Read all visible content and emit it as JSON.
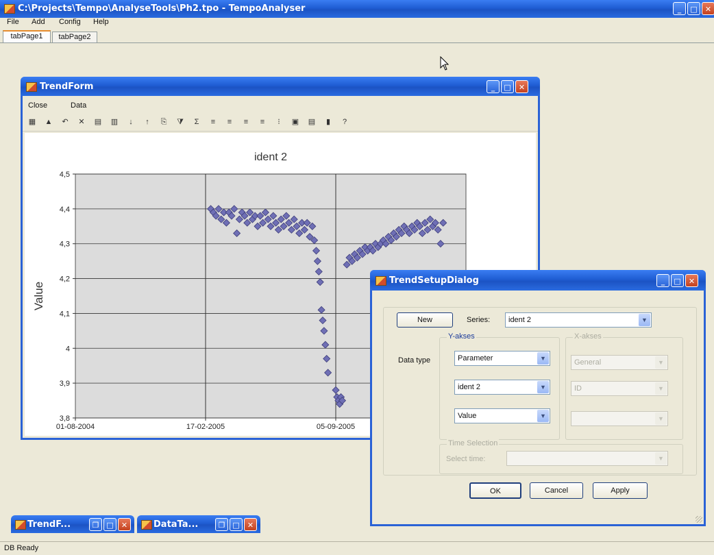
{
  "app": {
    "title": "C:\\Projects\\Tempo\\AnalyseTools\\Ph2.tpo  -  TempoAnalyser",
    "menu": [
      "File",
      "Add",
      "Config",
      "Help"
    ],
    "tabs": [
      "tabPage1",
      "tabPage2"
    ],
    "status": "DB Ready"
  },
  "trend_form": {
    "title": "TrendForm",
    "menu": [
      "Close",
      "Data"
    ],
    "toolbar_icons": [
      "grid-icon",
      "chart-icon",
      "undo-icon",
      "delete-icon",
      "table-icon",
      "list-icon",
      "sort-asc-icon",
      "sort-desc-icon",
      "copy-icon",
      "filter-icon",
      "sum-icon",
      "align-left-icon",
      "align-center-icon",
      "align-right-icon",
      "align-justify-icon",
      "info-icon",
      "export-icon",
      "print-icon",
      "book-icon",
      "help-icon"
    ]
  },
  "chart_data": {
    "type": "scatter",
    "title": "ident 2",
    "xlabel": "",
    "ylabel": "Value",
    "ylim": [
      3.8,
      4.5
    ],
    "yticks": [
      "4,5",
      "4,4",
      "4,3",
      "4,2",
      "4,1",
      "4",
      "3,9",
      "3,8"
    ],
    "xticks": [
      "01-08-2004",
      "17-02-2005",
      "05-09-2005"
    ],
    "series": [
      {
        "color": "#6f6fb5",
        "points": [
          [
            "2005-02-25",
            4.4
          ],
          [
            "2005-03-01",
            4.39
          ],
          [
            "2005-03-05",
            4.38
          ],
          [
            "2005-03-09",
            4.4
          ],
          [
            "2005-03-13",
            4.37
          ],
          [
            "2005-03-17",
            4.39
          ],
          [
            "2005-03-21",
            4.36
          ],
          [
            "2005-03-25",
            4.39
          ],
          [
            "2005-03-29",
            4.38
          ],
          [
            "2005-04-02",
            4.4
          ],
          [
            "2005-04-06",
            4.33
          ],
          [
            "2005-04-10",
            4.37
          ],
          [
            "2005-04-14",
            4.39
          ],
          [
            "2005-04-18",
            4.38
          ],
          [
            "2005-04-22",
            4.36
          ],
          [
            "2005-04-26",
            4.39
          ],
          [
            "2005-04-30",
            4.37
          ],
          [
            "2005-05-04",
            4.38
          ],
          [
            "2005-05-08",
            4.35
          ],
          [
            "2005-05-12",
            4.38
          ],
          [
            "2005-05-16",
            4.36
          ],
          [
            "2005-05-20",
            4.39
          ],
          [
            "2005-05-24",
            4.37
          ],
          [
            "2005-05-28",
            4.35
          ],
          [
            "2005-06-01",
            4.38
          ],
          [
            "2005-06-05",
            4.36
          ],
          [
            "2005-06-09",
            4.34
          ],
          [
            "2005-06-13",
            4.37
          ],
          [
            "2005-06-17",
            4.35
          ],
          [
            "2005-06-21",
            4.38
          ],
          [
            "2005-06-25",
            4.36
          ],
          [
            "2005-06-29",
            4.34
          ],
          [
            "2005-07-03",
            4.37
          ],
          [
            "2005-07-07",
            4.35
          ],
          [
            "2005-07-11",
            4.33
          ],
          [
            "2005-07-15",
            4.36
          ],
          [
            "2005-07-19",
            4.34
          ],
          [
            "2005-07-23",
            4.36
          ],
          [
            "2005-07-27",
            4.32
          ],
          [
            "2005-07-31",
            4.35
          ],
          [
            "2005-08-03",
            4.31
          ],
          [
            "2005-08-06",
            4.28
          ],
          [
            "2005-08-08",
            4.25
          ],
          [
            "2005-08-10",
            4.22
          ],
          [
            "2005-08-12",
            4.19
          ],
          [
            "2005-08-14",
            4.11
          ],
          [
            "2005-08-16",
            4.08
          ],
          [
            "2005-08-18",
            4.05
          ],
          [
            "2005-08-20",
            4.01
          ],
          [
            "2005-08-22",
            3.97
          ],
          [
            "2005-08-24",
            3.93
          ],
          [
            "2005-09-05",
            3.88
          ],
          [
            "2005-09-07",
            3.86
          ],
          [
            "2005-09-09",
            3.85
          ],
          [
            "2005-09-11",
            3.84
          ],
          [
            "2005-09-13",
            3.86
          ],
          [
            "2005-09-15",
            3.85
          ],
          [
            "2005-09-22",
            4.24
          ],
          [
            "2005-09-26",
            4.26
          ],
          [
            "2005-09-30",
            4.25
          ],
          [
            "2005-10-04",
            4.27
          ],
          [
            "2005-10-08",
            4.26
          ],
          [
            "2005-10-12",
            4.28
          ],
          [
            "2005-10-16",
            4.27
          ],
          [
            "2005-10-20",
            4.29
          ],
          [
            "2005-10-24",
            4.28
          ],
          [
            "2005-10-28",
            4.29
          ],
          [
            "2005-11-01",
            4.28
          ],
          [
            "2005-11-05",
            4.3
          ],
          [
            "2005-11-09",
            4.29
          ],
          [
            "2005-11-13",
            4.3
          ],
          [
            "2005-11-17",
            4.31
          ],
          [
            "2005-11-21",
            4.3
          ],
          [
            "2005-11-25",
            4.32
          ],
          [
            "2005-11-29",
            4.31
          ],
          [
            "2005-12-03",
            4.33
          ],
          [
            "2005-12-07",
            4.32
          ],
          [
            "2005-12-11",
            4.34
          ],
          [
            "2005-12-15",
            4.33
          ],
          [
            "2005-12-19",
            4.35
          ],
          [
            "2005-12-23",
            4.34
          ],
          [
            "2005-12-27",
            4.33
          ],
          [
            "2005-12-31",
            4.35
          ],
          [
            "2006-01-04",
            4.34
          ],
          [
            "2006-01-08",
            4.36
          ],
          [
            "2006-01-12",
            4.35
          ],
          [
            "2006-01-16",
            4.33
          ],
          [
            "2006-01-20",
            4.36
          ],
          [
            "2006-01-24",
            4.34
          ],
          [
            "2006-01-28",
            4.37
          ],
          [
            "2006-02-01",
            4.35
          ],
          [
            "2006-02-05",
            4.36
          ],
          [
            "2006-02-09",
            4.34
          ],
          [
            "2006-02-13",
            4.3
          ],
          [
            "2006-02-17",
            4.36
          ]
        ]
      }
    ]
  },
  "dialog": {
    "title": "TrendSetupDialog",
    "new_label": "New",
    "series_label": "Series:",
    "series_value": "ident 2",
    "yaxes_label": "Y-akses",
    "xaxes_label": "X-akses",
    "datatype_label": "Data type",
    "y_combo1": "Parameter",
    "y_combo2": "ident 2",
    "y_combo3": "Value",
    "x_combo1": "General",
    "x_combo2": "ID",
    "x_combo3": "",
    "time_selection_label": "Time Selection",
    "select_time_label": "Select time:",
    "ok_label": "OK",
    "cancel_label": "Cancel",
    "apply_label": "Apply"
  },
  "taskbar": [
    {
      "label": "TrendF..."
    },
    {
      "label": "DataTa..."
    }
  ]
}
